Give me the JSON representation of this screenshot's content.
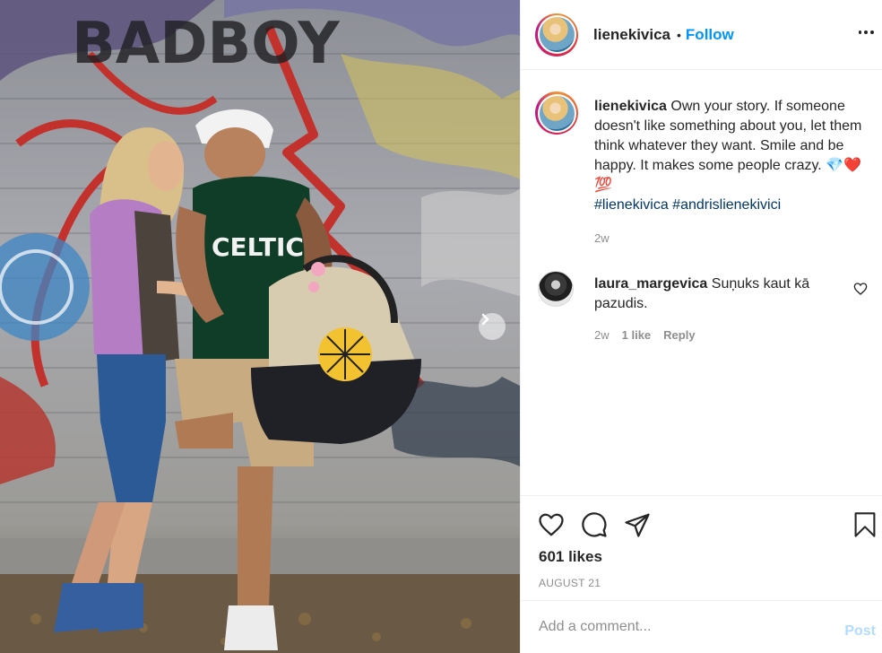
{
  "post": {
    "username": "lienekivica",
    "follow_label": "Follow",
    "caption": {
      "username": "lienekivica",
      "text": "Own your story. If someone doesn't like something about you, let them think whatever they want. Smile and be happy. It makes some people crazy.",
      "emojis": "💎❤️💯",
      "hashtags": [
        "#lienekivica",
        "#andrislienekivici"
      ],
      "time": "2w"
    },
    "comments": [
      {
        "username": "laura_margevica",
        "text": "Suņuks kaut kā pazudis.",
        "time": "2w",
        "likes_label": "1 like",
        "reply_label": "Reply"
      }
    ],
    "likes_text": "601 likes",
    "date": "AUGUST 21",
    "add_comment_placeholder": "Add a comment...",
    "post_label": "Post"
  },
  "photo": {
    "jersey_text": "CELTICS",
    "wall_graffiti_text": "BADBOY"
  },
  "colors": {
    "accent": "#0095f6",
    "post_disabled": "#b3dbff",
    "hashtag": "#00376b",
    "muted": "#8e8e8e"
  },
  "icons": [
    "ellipsis-icon",
    "heart-icon",
    "comment-icon",
    "share-icon",
    "bookmark-icon",
    "chevron-right-icon"
  ]
}
